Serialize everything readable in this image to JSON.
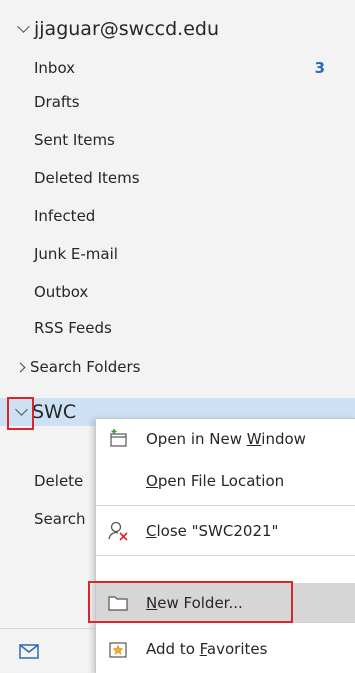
{
  "account1": {
    "name": "jjaguar@swccd.edu",
    "folders": [
      {
        "label": "Inbox",
        "badge": "3"
      },
      {
        "label": "Drafts"
      },
      {
        "label": "Sent Items"
      },
      {
        "label": "Deleted Items"
      },
      {
        "label": "Infected"
      },
      {
        "label": "Junk E-mail"
      },
      {
        "label": "Outbox"
      },
      {
        "label": "RSS Feeds"
      }
    ],
    "search_folders": "Search Folders"
  },
  "account2": {
    "name": "SWC2021",
    "name_visible": "SWC",
    "folders": [
      {
        "label": "Delete"
      },
      {
        "label": "Search"
      }
    ]
  },
  "context_menu": {
    "items": [
      {
        "pre": "Open in New ",
        "key": "W",
        "post": "indow",
        "icon": "open-window-icon"
      },
      {
        "pre": "",
        "key": "O",
        "post": "pen File Location",
        "icon": ""
      },
      {
        "pre": "",
        "key": "C",
        "post": "lose \"SWC2021\"",
        "icon": "close-account-icon"
      },
      {
        "pre": "",
        "key": "N",
        "post": "ew Folder...",
        "icon": "folder-icon"
      },
      {
        "pre": "Add to ",
        "key": "F",
        "post": "avorites",
        "icon": "star-favorites-icon"
      }
    ]
  },
  "colors": {
    "accent": "#2b6cb4",
    "selection": "#cde0f4",
    "annotation": "#d9262b"
  }
}
